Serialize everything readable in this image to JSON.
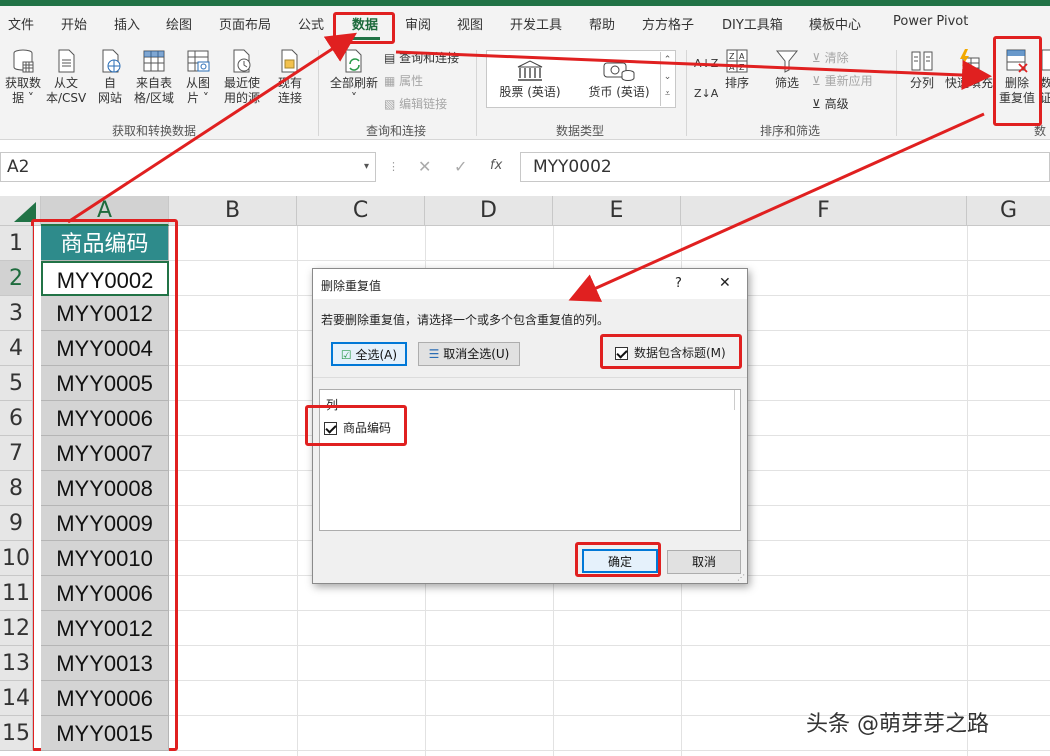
{
  "tabs": [
    "文件",
    "开始",
    "插入",
    "绘图",
    "页面布局",
    "公式",
    "数据",
    "审阅",
    "视图",
    "开发工具",
    "帮助",
    "方方格子",
    "DIY工具箱",
    "模板中心",
    "Power Pivot"
  ],
  "active_tab": "数据",
  "ribbon": {
    "get_data": [
      "获取数",
      "据 ˅"
    ],
    "from_text": [
      "从文",
      "本/CSV"
    ],
    "from_web": [
      "自",
      "网站"
    ],
    "from_table": [
      "来自表",
      "格/区域"
    ],
    "from_picture": [
      "从图",
      "片 ˅"
    ],
    "recent_sources": [
      "最近使",
      "用的源"
    ],
    "existing_conn": [
      "现有",
      "连接"
    ],
    "group_get_transform": "获取和转换数据",
    "refresh_all": [
      "全部刷新",
      "˅"
    ],
    "queries_conn": "查询和连接",
    "properties": "属性",
    "edit_links": "编辑链接",
    "group_queries": "查询和连接",
    "stock": "股票 (英语)",
    "currency": "货币 (英语)",
    "group_datatype": "数据类型",
    "sort": "排序",
    "filter": "筛选",
    "clear": "清除",
    "reapply": "重新应用",
    "advanced": "高级",
    "group_sort_filter": "排序和筛选",
    "split": "分列",
    "flash_fill": "快速填充",
    "remove_dup": [
      "删除",
      "重复值"
    ],
    "data_val": [
      "数",
      "证"
    ],
    "group_tools_partial": "数"
  },
  "formula_bar": {
    "name_box": "A2",
    "formula": "MYY0002",
    "fx": "fx"
  },
  "columns": [
    "A",
    "B",
    "C",
    "D",
    "E",
    "F",
    "G"
  ],
  "rows": [
    "1",
    "2",
    "3",
    "4",
    "5",
    "6",
    "7",
    "8",
    "9",
    "10",
    "11",
    "12",
    "13",
    "14",
    "15"
  ],
  "column_a": [
    "商品编码",
    "MYY0002",
    "MYY0012",
    "MYY0004",
    "MYY0005",
    "MYY0006",
    "MYY0007",
    "MYY0008",
    "MYY0009",
    "MYY0010",
    "MYY0006",
    "MYY0012",
    "MYY0013",
    "MYY0006",
    "MYY0015"
  ],
  "dialog": {
    "title": "删除重复值",
    "help": "?",
    "close": "✕",
    "instruction": "若要删除重复值，请选择一个或多个包含重复值的列。",
    "select_all": "全选(A)",
    "unselect_all": "取消全选(U)",
    "has_headers": "数据包含标题(M)",
    "list_header": "列",
    "column_item": "商品编码",
    "ok": "确定",
    "cancel": "取消"
  },
  "watermark": "头条 @萌芽芽之路",
  "colors": {
    "excel_green": "#217346",
    "header_teal": "#2e8b8b",
    "annotation_red": "#e02020"
  }
}
